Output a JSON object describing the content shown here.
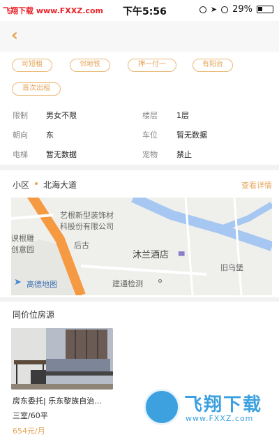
{
  "status_bar": {
    "watermark": "飞翔下载 www.FXXZ.com",
    "time": "下午5:56",
    "battery": "29%"
  },
  "nav": {
    "back_icon": "chevron-left-icon"
  },
  "tags": [
    "可短租",
    "邻地铁",
    "押一付一",
    "有阳台",
    "首次出租"
  ],
  "info": [
    {
      "label": "限制",
      "value": "男女不限"
    },
    {
      "label": "楼层",
      "value": "1层"
    },
    {
      "label": "朝向",
      "value": "东"
    },
    {
      "label": "车位",
      "value": "暂无数据"
    },
    {
      "label": "电梯",
      "value": "暂无数据"
    },
    {
      "label": "宠物",
      "value": "禁止"
    }
  ],
  "community": {
    "label": "小区",
    "name": "北海大道",
    "link": "查看详情"
  },
  "map": {
    "poi_1a": "艺根新型装饰材",
    "poi_1b": "科股份有限公司",
    "poi_2a": "谀根雕",
    "poi_2b": "创意园",
    "poi_3": "后古",
    "poi_hotel": "沐兰酒店",
    "poi_4": "旧乌堡",
    "poi_5": "建通检测",
    "logo": "高德地图"
  },
  "same_price": {
    "title": "同价位房源",
    "listing": {
      "title": "房东委托| 乐东黎族自治...",
      "spec": "三室/60平",
      "price": "654元/月"
    }
  },
  "watermark_logo": {
    "cn": "飞翔下载",
    "url": "www.FXXZ.com"
  },
  "colors": {
    "accent": "#e4a55a",
    "watermark_red": "#e8242b",
    "watermark_blue": "#3da1e0"
  }
}
